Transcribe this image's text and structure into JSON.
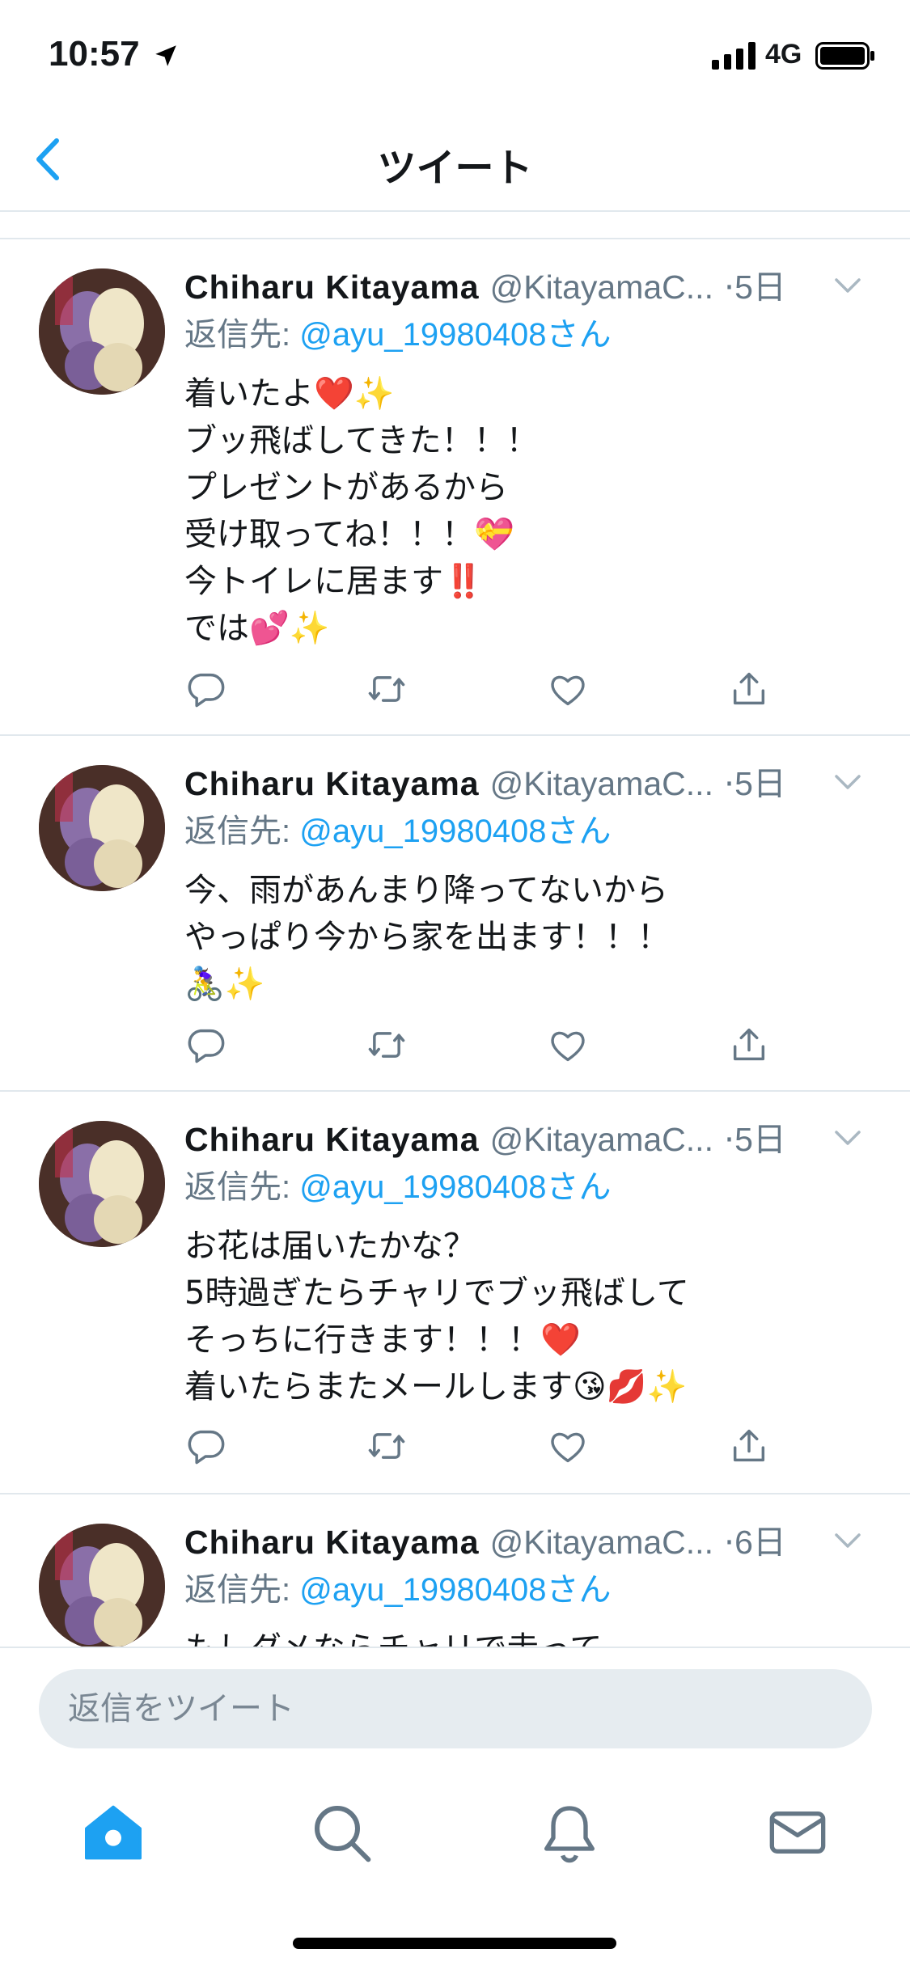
{
  "status_bar": {
    "time": "10:57",
    "network": "4G"
  },
  "nav": {
    "title": "ツイート"
  },
  "tweets": [
    {
      "display_name": "Chiharu  Kitayama",
      "handle": "@KitayamaC...",
      "time": "5日",
      "reply_prefix": "返信先: ",
      "reply_mention": "@ayu_19980408さん",
      "text": "着いたよ❤️✨\nブッ飛ばしてきた！！！\nプレゼントがあるから\n受け取ってね！！！💝\n今トイレに居ます‼️\nでは💕✨"
    },
    {
      "display_name": "Chiharu  Kitayama",
      "handle": "@KitayamaC...",
      "time": "5日",
      "reply_prefix": "返信先: ",
      "reply_mention": "@ayu_19980408さん",
      "text": "今、雨があんまり降ってないから\nやっぱり今から家を出ます！！！\n🚴‍♀️✨"
    },
    {
      "display_name": "Chiharu  Kitayama",
      "handle": "@KitayamaC...",
      "time": "5日",
      "reply_prefix": "返信先: ",
      "reply_mention": "@ayu_19980408さん",
      "text": "お花は届いたかな？\n5時過ぎたらチャリでブッ飛ばして\nそっちに行きます！！！❤️\n着いたらまたメールします😘💋✨"
    },
    {
      "display_name": "Chiharu  Kitayama",
      "handle": "@KitayamaC...",
      "time": "6日",
      "reply_prefix": "返信先: ",
      "reply_mention": "@ayu_19980408さん",
      "text": "もしダメならチャリで走って"
    }
  ],
  "composer": {
    "placeholder": "返信をツイート"
  },
  "tabs": [
    "home-icon",
    "search-icon",
    "notifications-icon",
    "messages-icon"
  ],
  "colors": {
    "accent": "#1da1f2",
    "secondary_text": "#657786",
    "divider": "#e1e8ed",
    "composer_bg": "#e6ecf0"
  }
}
